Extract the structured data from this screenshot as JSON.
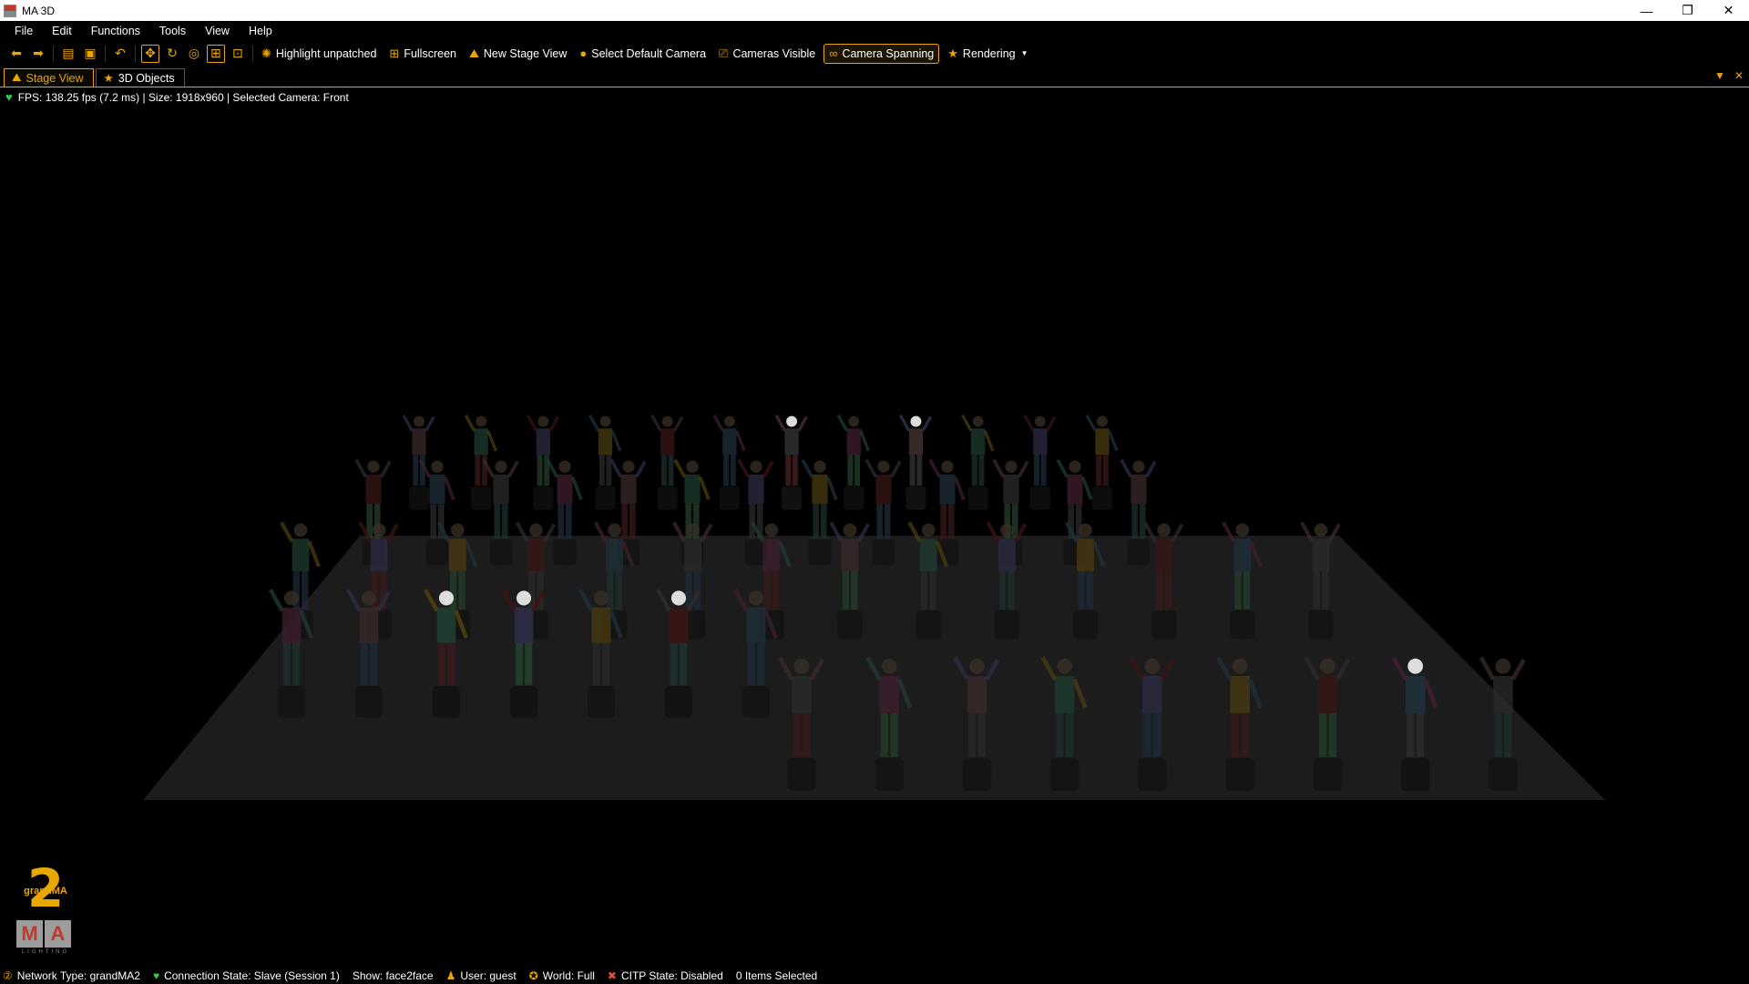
{
  "window": {
    "title": "MA 3D",
    "controls": {
      "minimize": "—",
      "restore": "❐",
      "close": "✕"
    }
  },
  "menu": [
    "File",
    "Edit",
    "Functions",
    "Tools",
    "View",
    "Help"
  ],
  "toolbar": {
    "icons": [
      "back-arrow-icon",
      "forward-arrow-icon",
      "open-folder-icon",
      "save-icon",
      "undo-icon",
      "move-icon",
      "rotate-icon",
      "target-icon",
      "select-frame-icon",
      "zoom-frame-icon"
    ],
    "buttons": [
      {
        "label": "Highlight unpatched",
        "icon": "lightbulb-icon",
        "active": false
      },
      {
        "label": "Fullscreen",
        "icon": "fullscreen-icon",
        "active": false
      },
      {
        "label": "New Stage View",
        "icon": "stage-icon",
        "active": false
      },
      {
        "label": "Select Default Camera",
        "icon": "camera-circle-icon",
        "active": false
      },
      {
        "label": "Cameras Visible",
        "icon": "camera-icon",
        "active": false
      },
      {
        "label": "Camera Spanning",
        "icon": "camera-span-icon",
        "active": true
      },
      {
        "label": "Rendering",
        "icon": "star-icon",
        "active": false
      }
    ]
  },
  "tabs": [
    {
      "label": "Stage View",
      "icon": "stage-icon",
      "active": true
    },
    {
      "label": "3D Objects",
      "icon": "star-icon",
      "active": false
    }
  ],
  "info": "FPS: 138.25 fps (7.2 ms) | Size: 1918x960 | Selected Camera: Front",
  "logo": {
    "number": "2",
    "brand": "grandMA",
    "letters": [
      "M",
      "A"
    ],
    "sub": "LIGHTING"
  },
  "status": {
    "network": "Network Type: grandMA2",
    "connection": "Connection State: Slave (Session 1)",
    "show": "Show: face2face",
    "user": "User: guest",
    "world": "World: Full",
    "citp": "CITP State: Disabled",
    "selection": "0 Items Selected"
  },
  "colors": {
    "accent": "#e8a800",
    "background": "#000000",
    "stage": "#1e1e1e"
  }
}
